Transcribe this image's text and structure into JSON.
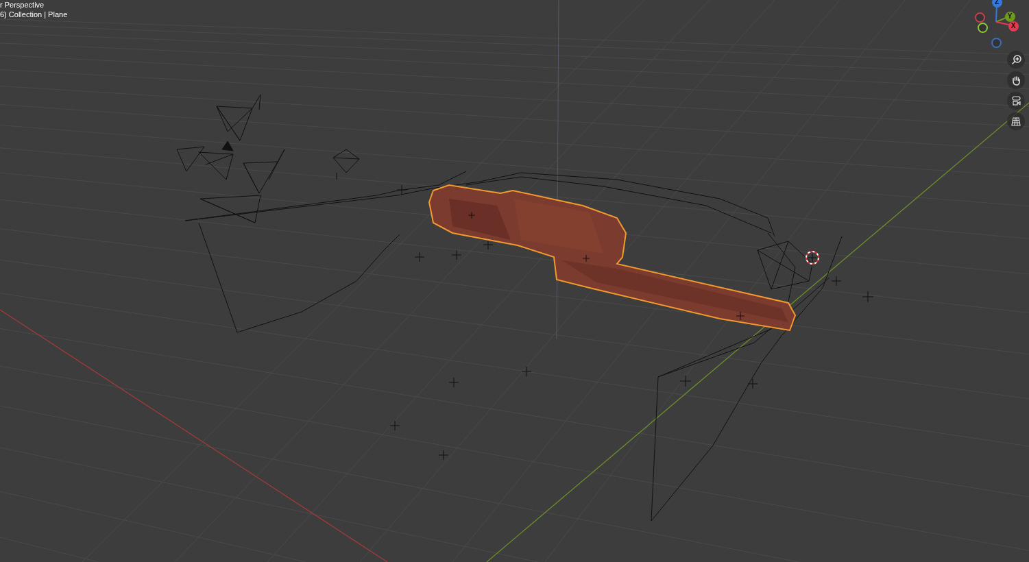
{
  "viewport": {
    "view_label": "r Perspective",
    "object_info": "6) Collection | Plane"
  },
  "gizmo": [
    {
      "kind": "ring",
      "color": "#c8404f"
    },
    {
      "kind": "ring",
      "color": "#8ccc2a"
    },
    {
      "kind": "ring",
      "color": "#3a6fc0"
    },
    {
      "kind": "filled",
      "label": "Z",
      "color": "#2f7be0"
    },
    {
      "kind": "filled",
      "label": "Y",
      "color": "#6e9a1e"
    },
    {
      "kind": "filled",
      "label": "X",
      "color": "#e53950"
    }
  ],
  "nav_buttons": [
    {
      "kind": "zoom"
    },
    {
      "kind": "pan"
    },
    {
      "kind": "camera"
    },
    {
      "kind": "ortho"
    }
  ]
}
